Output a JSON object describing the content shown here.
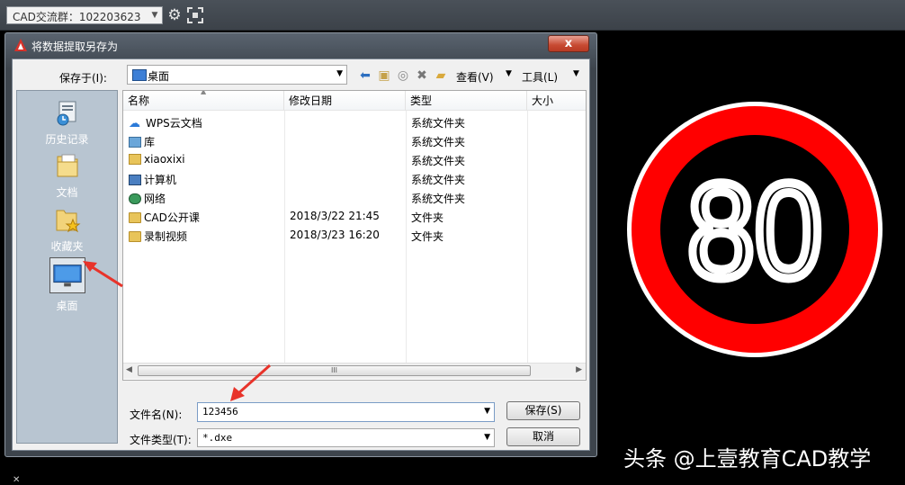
{
  "topbar": {
    "combo_text": "CAD交流群：102203623",
    "settings_icon": "gear-icon",
    "select_icon": "selection-frame-icon"
  },
  "dialog": {
    "title": "将数据提取另存为",
    "close_label": "x",
    "save_in_label": "保存于(I):",
    "save_in_value": "桌面",
    "view_label": "查看(V)",
    "tools_label": "工具(L)",
    "places": [
      {
        "label": "历史记录",
        "icon": "history-icon"
      },
      {
        "label": "文档",
        "icon": "documents-icon"
      },
      {
        "label": "收藏夹",
        "icon": "favorites-icon"
      },
      {
        "label": "桌面",
        "icon": "desktop-icon"
      }
    ],
    "columns": [
      "名称",
      "修改日期",
      "类型",
      "大小"
    ],
    "files": [
      {
        "name": "WPS云文档",
        "date": "",
        "type": "系统文件夹",
        "icon": "cloud-icon"
      },
      {
        "name": "库",
        "date": "",
        "type": "系统文件夹",
        "icon": "library-icon"
      },
      {
        "name": "xiaoxixi",
        "date": "",
        "type": "系统文件夹",
        "icon": "user-folder-icon"
      },
      {
        "name": "计算机",
        "date": "",
        "type": "系统文件夹",
        "icon": "computer-icon"
      },
      {
        "name": "网络",
        "date": "",
        "type": "系统文件夹",
        "icon": "network-icon"
      },
      {
        "name": "CAD公开课",
        "date": "2018/3/22 21:45",
        "type": "文件夹",
        "icon": "folder-icon"
      },
      {
        "name": "录制视频",
        "date": "2018/3/23 16:20",
        "type": "文件夹",
        "icon": "folder-icon"
      }
    ],
    "scroll_thumb": "III",
    "filename_label": "文件名(N):",
    "filename_value": "123456",
    "filetype_label": "文件类型(T):",
    "filetype_value": "*.dxe",
    "save_label": "保存(S)",
    "cancel_label": "取消"
  },
  "sign": {
    "number": "80",
    "ring_color": "#ff0000",
    "inner_color": "#000000",
    "outer_color": "#ffffff"
  },
  "watermark": "头条 @上壹教育CAD教学",
  "colors": {
    "arrow": "#e8332a",
    "places_bg": "#b8c5d1",
    "dialog_frame": "#3d444c"
  }
}
